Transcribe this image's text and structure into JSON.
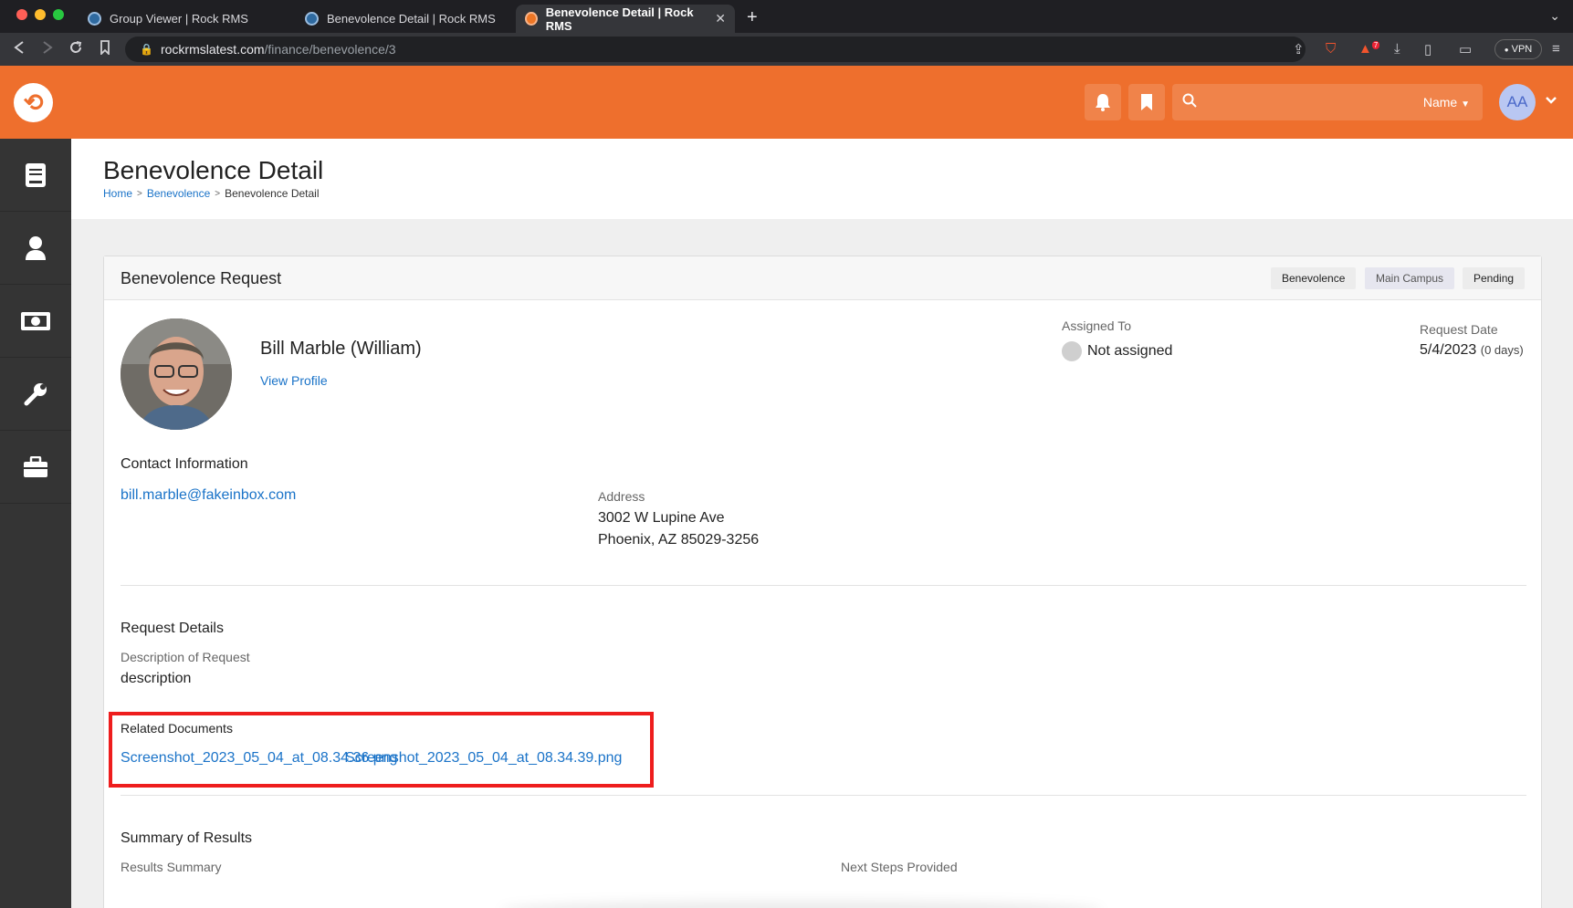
{
  "browser": {
    "tabs": [
      {
        "title": "Group Viewer | Rock RMS",
        "active": false
      },
      {
        "title": "Benevolence Detail | Rock RMS",
        "active": false
      },
      {
        "title": "Benevolence Detail | Rock RMS",
        "active": true
      }
    ],
    "url_host": "rockrmslatest.com",
    "url_path": "/finance/benevolence/3",
    "vpn_label": "VPN",
    "notif_count": "7"
  },
  "header": {
    "search_scope": "Name",
    "search_placeholder": "",
    "avatar_initials": "AA",
    "accent_color": "#ee6f2d"
  },
  "sidebar": {
    "items": [
      {
        "icon": "book-icon"
      },
      {
        "icon": "person-icon"
      },
      {
        "icon": "money-icon"
      },
      {
        "icon": "wrench-icon"
      },
      {
        "icon": "briefcase-icon"
      }
    ]
  },
  "page": {
    "title": "Benevolence Detail",
    "breadcrumb": [
      "Home",
      "Benevolence",
      "Benevolence Detail"
    ]
  },
  "panel": {
    "title": "Benevolence Request",
    "labels": [
      "Benevolence",
      "Main Campus",
      "Pending"
    ]
  },
  "person": {
    "name": "Bill Marble (William)",
    "view_profile": "View Profile"
  },
  "assigned": {
    "label": "Assigned To",
    "value": "Not assigned"
  },
  "request_date": {
    "label": "Request Date",
    "date": "5/4/2023",
    "age": "(0 days)"
  },
  "contact": {
    "heading": "Contact Information",
    "email": "bill.marble@fakeinbox.com",
    "address_label": "Address",
    "address_line1": "3002 W Lupine Ave",
    "address_line2": "Phoenix, AZ 85029-3256"
  },
  "request_details": {
    "heading": "Request Details",
    "description_label": "Description of Request",
    "description": "description"
  },
  "related_documents": {
    "heading": "Related Documents",
    "files": [
      "Screenshot_2023_05_04_at_08.34.36.png",
      "Screenshot_2023_05_04_at_08.34.39.png"
    ]
  },
  "summary": {
    "heading": "Summary of Results",
    "results_label": "Results Summary",
    "next_steps_label": "Next Steps Provided"
  }
}
